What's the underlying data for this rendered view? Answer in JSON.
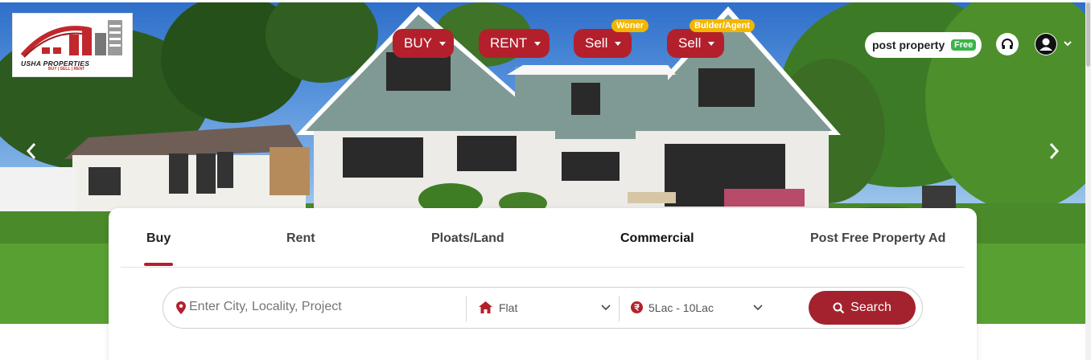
{
  "brand": {
    "name": "USHA PROPERTIES",
    "tagline": "BUY | SELL | RENT"
  },
  "top_nav": {
    "items": [
      {
        "label": "BUY",
        "badge": ""
      },
      {
        "label": "RENT",
        "badge": ""
      },
      {
        "label": "Sell",
        "badge": "Woner"
      },
      {
        "label": "Sell",
        "badge": "Bulder/Agent"
      }
    ],
    "post_property_label": "post property",
    "free_badge": "Free"
  },
  "search_panel": {
    "tabs": [
      {
        "label": "Buy",
        "active": true
      },
      {
        "label": "Rent",
        "active": false
      },
      {
        "label": "Ploats/Land",
        "active": false
      },
      {
        "label": "Commercial",
        "active": false
      },
      {
        "label": "Post Free Property Ad",
        "active": false
      }
    ],
    "location_placeholder": "Enter City, Locality, Project",
    "property_type": "Flat",
    "budget": "5Lac - 10Lac",
    "search_label": "Search"
  },
  "colors": {
    "accent": "#b3202c",
    "badge_yellow": "#f2b600",
    "free_green": "#3bb54a"
  },
  "icons": [
    "map-pin-icon",
    "home-icon",
    "rupee-icon",
    "search-icon",
    "headphones-icon",
    "user-icon",
    "chevron-left-icon",
    "chevron-right-icon",
    "chevron-down-icon"
  ]
}
